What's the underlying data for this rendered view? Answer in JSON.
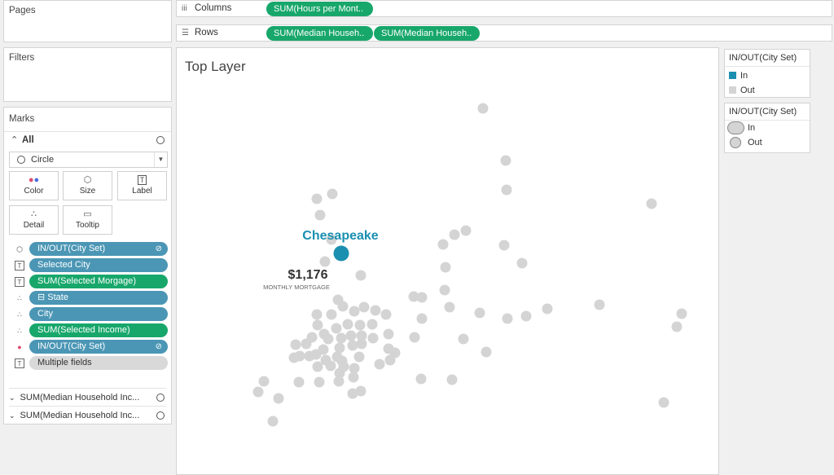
{
  "pages": {
    "title": "Pages"
  },
  "filters": {
    "title": "Filters"
  },
  "columns": {
    "label": "Columns",
    "pills": [
      "SUM(Hours per Mont.."
    ]
  },
  "rows": {
    "label": "Rows",
    "pills": [
      "SUM(Median Househ..",
      "SUM(Median Househ.."
    ]
  },
  "marks": {
    "title": "Marks",
    "all_label": "All",
    "mark_type": "Circle",
    "buttons": {
      "color": "Color",
      "size": "Size",
      "label": "Label",
      "detail": "Detail",
      "tooltip": "Tooltip"
    },
    "pills": [
      {
        "text": "IN/OUT(City Set)",
        "kind": "blue",
        "icon": "size-icon",
        "set": true
      },
      {
        "text": "Selected City",
        "kind": "blue",
        "icon": "label-icon",
        "set": false
      },
      {
        "text": "SUM(Selected Morgage)",
        "kind": "green",
        "icon": "label-icon",
        "set": false
      },
      {
        "text": "⊟  State",
        "kind": "blue",
        "icon": "detail-icon",
        "set": false
      },
      {
        "text": "City",
        "kind": "blue",
        "icon": "detail-icon",
        "set": false
      },
      {
        "text": "SUM(Selected Income)",
        "kind": "green",
        "icon": "detail-icon",
        "set": false
      },
      {
        "text": "IN/OUT(City Set)",
        "kind": "blue",
        "icon": "color-icon",
        "set": true
      },
      {
        "text": "Multiple fields",
        "kind": "grey",
        "icon": "label-icon",
        "set": false
      }
    ],
    "sub_cards": [
      "SUM(Median Household Inc...",
      "SUM(Median Household Inc..."
    ]
  },
  "view": {
    "title": "Top Layer",
    "highlight_city": "Chesapeake",
    "highlight_value": "$1,176",
    "highlight_caption": "MONTHLY MORTGAGE"
  },
  "legend_color": {
    "title": "IN/OUT(City Set)",
    "items": [
      {
        "label": "In",
        "color": "#1a8fb0"
      },
      {
        "label": "Out",
        "color": "#d4d4d4"
      }
    ]
  },
  "legend_size": {
    "title": "IN/OUT(City Set)",
    "items": [
      {
        "label": "In"
      },
      {
        "label": "Out"
      }
    ]
  },
  "colors": {
    "in": "#1a8fb0",
    "out": "#d4d4d4",
    "pill_green": "#18a76b",
    "pill_blue": "#4b96b5"
  },
  "chart_data": {
    "type": "scatter",
    "title": "Top Layer",
    "series": [
      {
        "name": "Out",
        "color": "#d4d4d4",
        "points": [
          [
            592,
            132
          ],
          [
            620,
            196
          ],
          [
            621,
            232
          ],
          [
            388,
            243
          ],
          [
            407,
            237
          ],
          [
            392,
            263
          ],
          [
            799,
            249
          ],
          [
            571,
            282
          ],
          [
            557,
            287
          ],
          [
            543,
            299
          ],
          [
            406,
            293
          ],
          [
            618,
            300
          ],
          [
            546,
            327
          ],
          [
            640,
            322
          ],
          [
            398,
            320
          ],
          [
            442,
            337
          ],
          [
            545,
            355
          ],
          [
            414,
            367
          ],
          [
            388,
            385
          ],
          [
            406,
            385
          ],
          [
            420,
            375
          ],
          [
            434,
            381
          ],
          [
            446,
            376
          ],
          [
            460,
            380
          ],
          [
            473,
            385
          ],
          [
            507,
            363
          ],
          [
            517,
            364
          ],
          [
            551,
            376
          ],
          [
            588,
            383
          ],
          [
            622,
            390
          ],
          [
            645,
            387
          ],
          [
            671,
            378
          ],
          [
            735,
            373
          ],
          [
            517,
            390
          ],
          [
            836,
            384
          ],
          [
            830,
            400
          ],
          [
            389,
            398
          ],
          [
            397,
            409
          ],
          [
            412,
            402
          ],
          [
            426,
            397
          ],
          [
            441,
            398
          ],
          [
            456,
            397
          ],
          [
            382,
            413
          ],
          [
            402,
            415
          ],
          [
            418,
            414
          ],
          [
            430,
            411
          ],
          [
            443,
            411
          ],
          [
            457,
            414
          ],
          [
            476,
            409
          ],
          [
            508,
            413
          ],
          [
            568,
            415
          ],
          [
            362,
            422
          ],
          [
            375,
            421
          ],
          [
            396,
            428
          ],
          [
            416,
            426
          ],
          [
            432,
            423
          ],
          [
            443,
            421
          ],
          [
            360,
            438
          ],
          [
            367,
            436
          ],
          [
            379,
            436
          ],
          [
            387,
            434
          ],
          [
            399,
            441
          ],
          [
            413,
            437
          ],
          [
            419,
            442
          ],
          [
            440,
            437
          ],
          [
            476,
            427
          ],
          [
            484,
            432
          ],
          [
            596,
            431
          ],
          [
            389,
            449
          ],
          [
            405,
            448
          ],
          [
            421,
            449
          ],
          [
            434,
            451
          ],
          [
            465,
            446
          ],
          [
            478,
            441
          ],
          [
            323,
            467
          ],
          [
            366,
            468
          ],
          [
            391,
            468
          ],
          [
            415,
            467
          ],
          [
            416,
            457
          ],
          [
            433,
            462
          ],
          [
            516,
            464
          ],
          [
            554,
            465
          ],
          [
            316,
            480
          ],
          [
            432,
            482
          ],
          [
            442,
            479
          ],
          [
            341,
            488
          ],
          [
            814,
            493
          ],
          [
            334,
            516
          ]
        ]
      },
      {
        "name": "In",
        "color": "#1a8fb0",
        "points": [
          [
            418,
            310
          ]
        ],
        "label": "Chesapeake"
      }
    ]
  }
}
